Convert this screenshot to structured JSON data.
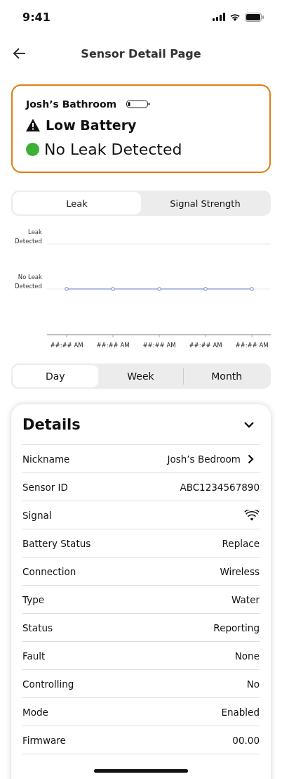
{
  "status_bar": {
    "time": "9:41"
  },
  "header": {
    "title": "Sensor Detail Page"
  },
  "sensor_card": {
    "name": "Josh’s Bathroom",
    "alert": "Low Battery",
    "status": "No Leak Detected",
    "leak_detected": false
  },
  "chart_tabs": [
    {
      "label": "Leak",
      "selected": true
    },
    {
      "label": "Signal Strength",
      "selected": false
    }
  ],
  "leak_chart": {
    "y_labels": [
      "Leak Detected",
      "No Leak Detected"
    ],
    "points": [
      {
        "time": "##:## AM",
        "leak": false
      },
      {
        "time": "##:## AM",
        "leak": false
      },
      {
        "time": "##:## AM",
        "leak": false
      },
      {
        "time": "##:## AM",
        "leak": false
      },
      {
        "time": "##:## AM",
        "leak": false
      }
    ]
  },
  "period_tabs": [
    {
      "label": "Day",
      "selected": true
    },
    {
      "label": "Week",
      "selected": false
    },
    {
      "label": "Month",
      "selected": false
    }
  ],
  "details": {
    "title": "Details",
    "expanded": true,
    "rows": [
      {
        "kind": "link",
        "label": "Nickname",
        "value": "Josh’s Bedroom"
      },
      {
        "kind": "text",
        "label": "Sensor ID",
        "value": "ABC1234567890"
      },
      {
        "kind": "signal",
        "label": "Signal"
      },
      {
        "kind": "text",
        "label": "Battery Status",
        "value": "Replace"
      },
      {
        "kind": "text",
        "label": "Connection",
        "value": "Wireless"
      },
      {
        "kind": "text",
        "label": "Type",
        "value": "Water"
      },
      {
        "kind": "text",
        "label": "Status",
        "value": "Reporting"
      },
      {
        "kind": "text",
        "label": "Fault",
        "value": "None"
      },
      {
        "kind": "text",
        "label": "Controlling",
        "value": "No"
      },
      {
        "kind": "text",
        "label": "Mode",
        "value": "Enabled"
      },
      {
        "kind": "text",
        "label": "Firmware",
        "value": "00.00"
      }
    ]
  }
}
